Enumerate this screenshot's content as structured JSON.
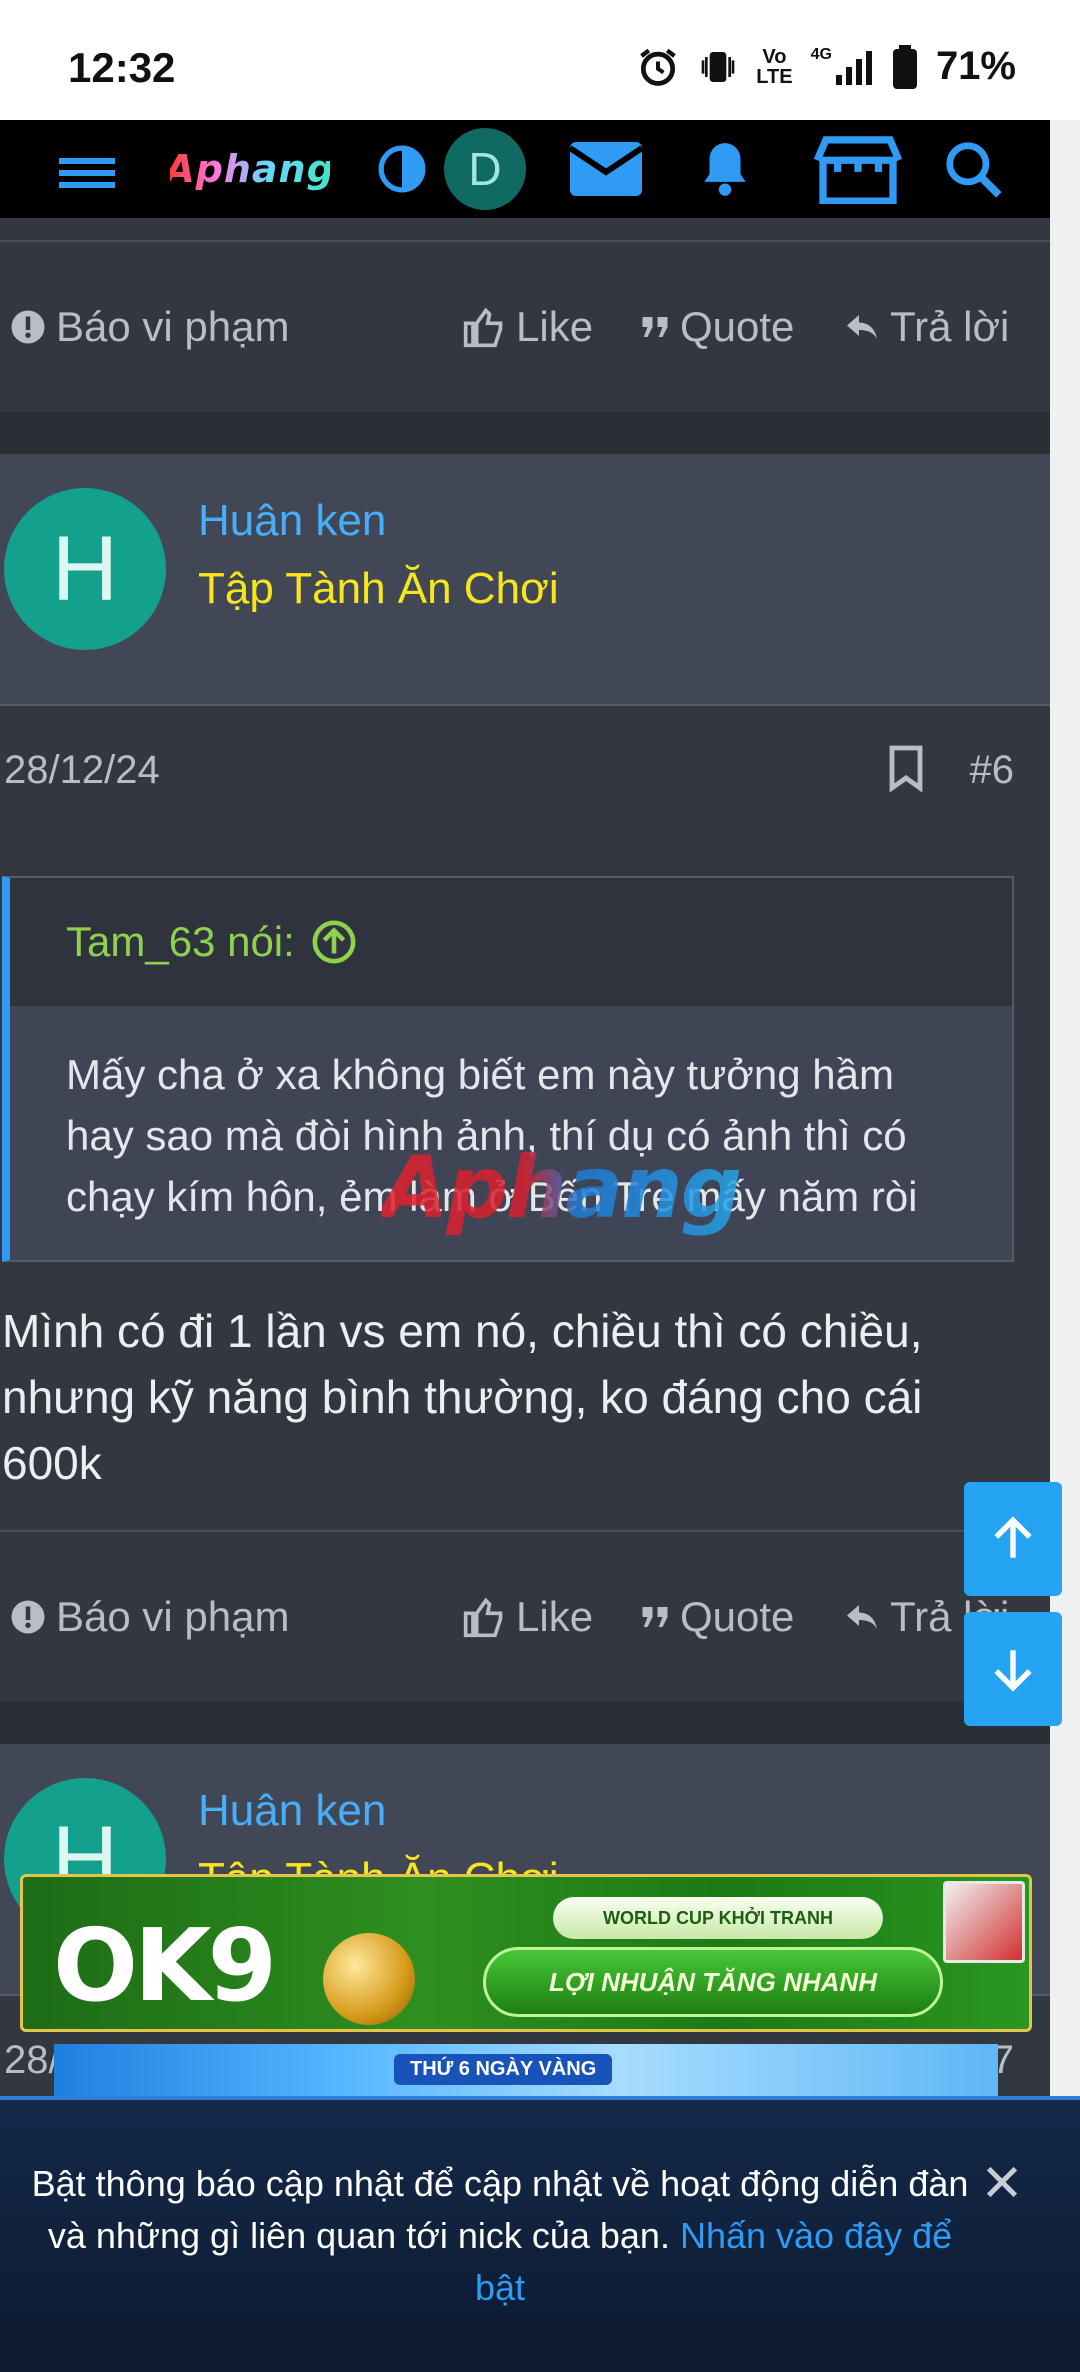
{
  "status_bar": {
    "time": "12:32",
    "volte_top": "Vo",
    "volte_bottom": "LTE",
    "network": "4G",
    "battery": "71%"
  },
  "header": {
    "logo_text": "Aphang",
    "avatar_letter": "D"
  },
  "post_actions": {
    "report": "Báo vi phạm",
    "like": "Like",
    "quote": "Quote",
    "reply": "Trả lời"
  },
  "posts": [
    {
      "author": "Huân ken",
      "author_title": "Tập Tành Ăn Chơi",
      "avatar_letter": "H",
      "date": "28/12/24",
      "number": "#6",
      "quote_author": "Tam_63 nói:",
      "quote_lines": [
        "Mấy cha ở xa không biết em này tưởng hầm",
        "hay sao mà đòi hình ảnh, thí dụ có ảnh thì có",
        "chạy kím hôn, ẻm làm ở Bến Tre mấy năm ròi"
      ],
      "body_lines": [
        "Mình có đi 1 lần vs em nó, chiều thì có chiều,",
        "nhưng kỹ năng bình thường, ko đáng cho cái",
        "600k"
      ]
    },
    {
      "author": "Huân ken",
      "author_title": "Tập Tành Ăn Chơi",
      "avatar_letter": "H",
      "date_partial": "28/",
      "number_partial": "7"
    }
  ],
  "watermark": "Aphang",
  "ads": {
    "ok9_logo": "OK9",
    "ok9_pill_top": "WORLD CUP KHỞI TRANH",
    "ok9_pill_main": "LỢI NHUẬN TĂNG NHANH",
    "strip_text": "THỨ 6 NGÀY VÀNG"
  },
  "notification": {
    "text": "Bật thông báo cập nhật để cập nhật về hoạt động diễn đàn và những gì liên quan tới nick của bạn. ",
    "link": "Nhấn vào đây để bật"
  },
  "colors": {
    "accent": "#2f9bf5",
    "username": "#47aefc",
    "user_title": "#f8e61c",
    "quote_author": "#8fd14f",
    "avatar_bg": "#13a08c"
  }
}
